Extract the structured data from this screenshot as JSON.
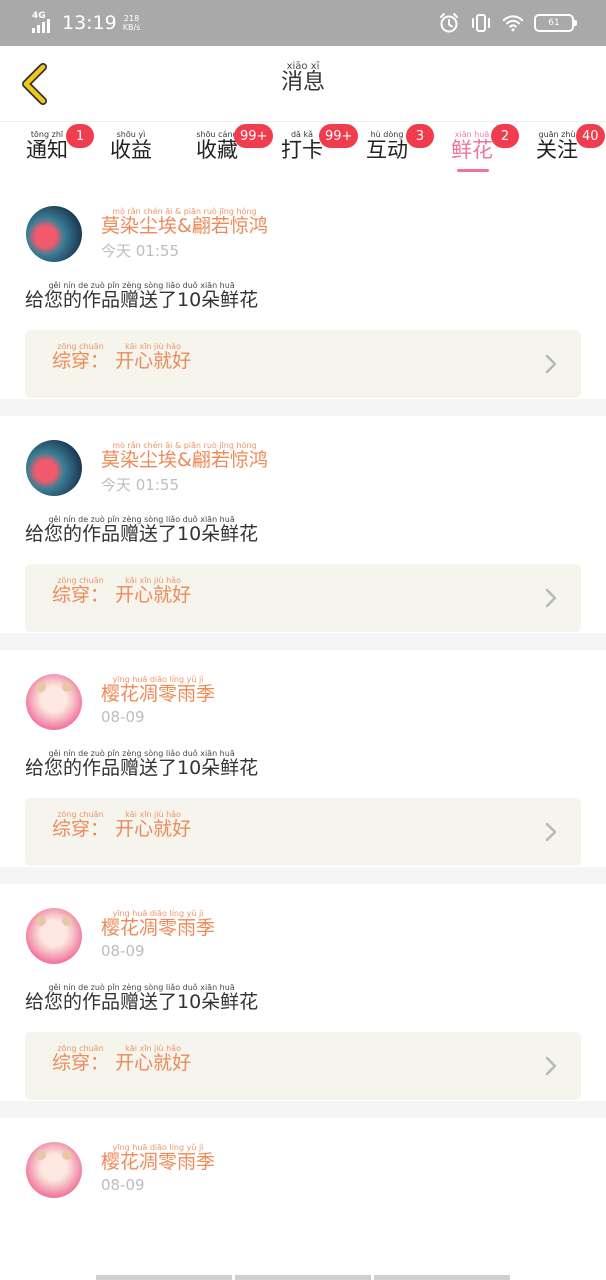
{
  "status_bar": {
    "network": "4G",
    "time": "13:19",
    "speed_value": "218",
    "speed_unit": "KB/s",
    "battery": "61"
  },
  "header": {
    "title": "消息",
    "title_pinyin": "xiāo xī"
  },
  "tabs": [
    {
      "label": "通知",
      "pinyin": "tōng zhī",
      "badge": "1"
    },
    {
      "label": "收益",
      "pinyin": "shōu yì",
      "badge": ""
    },
    {
      "label": "收藏",
      "pinyin": "shōu cáng",
      "badge": "99+"
    },
    {
      "label": "打卡",
      "pinyin": "dǎ kǎ",
      "badge": "99+"
    },
    {
      "label": "互动",
      "pinyin": "hù dòng",
      "badge": "3"
    },
    {
      "label": "鲜花",
      "pinyin": "xiān huā",
      "badge": "2",
      "active": true
    },
    {
      "label": "关注",
      "pinyin": "guān zhù",
      "badge": "40"
    }
  ],
  "feed": [
    {
      "user": "莫染尘埃&翩若惊鸿",
      "user_pinyin": "mò rǎn chén āi & piān ruò jīng hóng",
      "time": "今天 01:55",
      "message": "给您的作品赠送了10朵鲜花",
      "message_pinyin": "gěi nín de zuò pǐn zèng sòng liǎo duǒ xiān huā",
      "work_label": "综穿：",
      "work_label_pinyin": "zōng chuān",
      "work_title": "开心就好",
      "work_title_pinyin": "kāi xīn jiù hǎo"
    },
    {
      "user": "莫染尘埃&翩若惊鸿",
      "user_pinyin": "mò rǎn chén āi & piān ruò jīng hóng",
      "time": "今天 01:55",
      "message": "给您的作品赠送了10朵鲜花",
      "message_pinyin": "gěi nín de zuò pǐn zèng sòng liǎo duǒ xiān huā",
      "work_label": "综穿：",
      "work_label_pinyin": "zōng chuān",
      "work_title": "开心就好",
      "work_title_pinyin": "kāi xīn jiù hǎo"
    },
    {
      "user": "樱花凋零雨季",
      "user_pinyin": "yīng huā diāo líng yǔ jì",
      "time": "08-09",
      "message": "给您的作品赠送了10朵鲜花",
      "message_pinyin": "gěi nín de zuò pǐn zèng sòng liǎo duǒ xiān huā",
      "work_label": "综穿：",
      "work_label_pinyin": "zōng chuān",
      "work_title": "开心就好",
      "work_title_pinyin": "kāi xīn jiù hǎo"
    },
    {
      "user": "樱花凋零雨季",
      "user_pinyin": "yīng huā diāo líng yǔ jì",
      "time": "08-09",
      "message": "给您的作品赠送了10朵鲜花",
      "message_pinyin": "gěi nín de zuò pǐn zèng sòng liǎo duǒ xiān huā",
      "work_label": "综穿：",
      "work_label_pinyin": "zōng chuān",
      "work_title": "开心就好",
      "work_title_pinyin": "kāi xīn jiù hǎo"
    },
    {
      "user": "樱花凋零雨季",
      "user_pinyin": "yīng huā diāo líng yǔ jì",
      "time": "08-09"
    }
  ],
  "icons": {
    "back": "chevron-left-icon",
    "chevron": "chevron-right-icon",
    "alarm": "alarm-icon",
    "vibrate": "vibrate-icon",
    "wifi": "wifi-icon",
    "battery": "battery-icon"
  },
  "colors": {
    "accent_pink": "#f0739c",
    "name_orange": "#ee8a58",
    "badge_red": "#f03c4c",
    "back_yellow": "#f2c71c",
    "work_box_bg": "#f5f5ee"
  }
}
